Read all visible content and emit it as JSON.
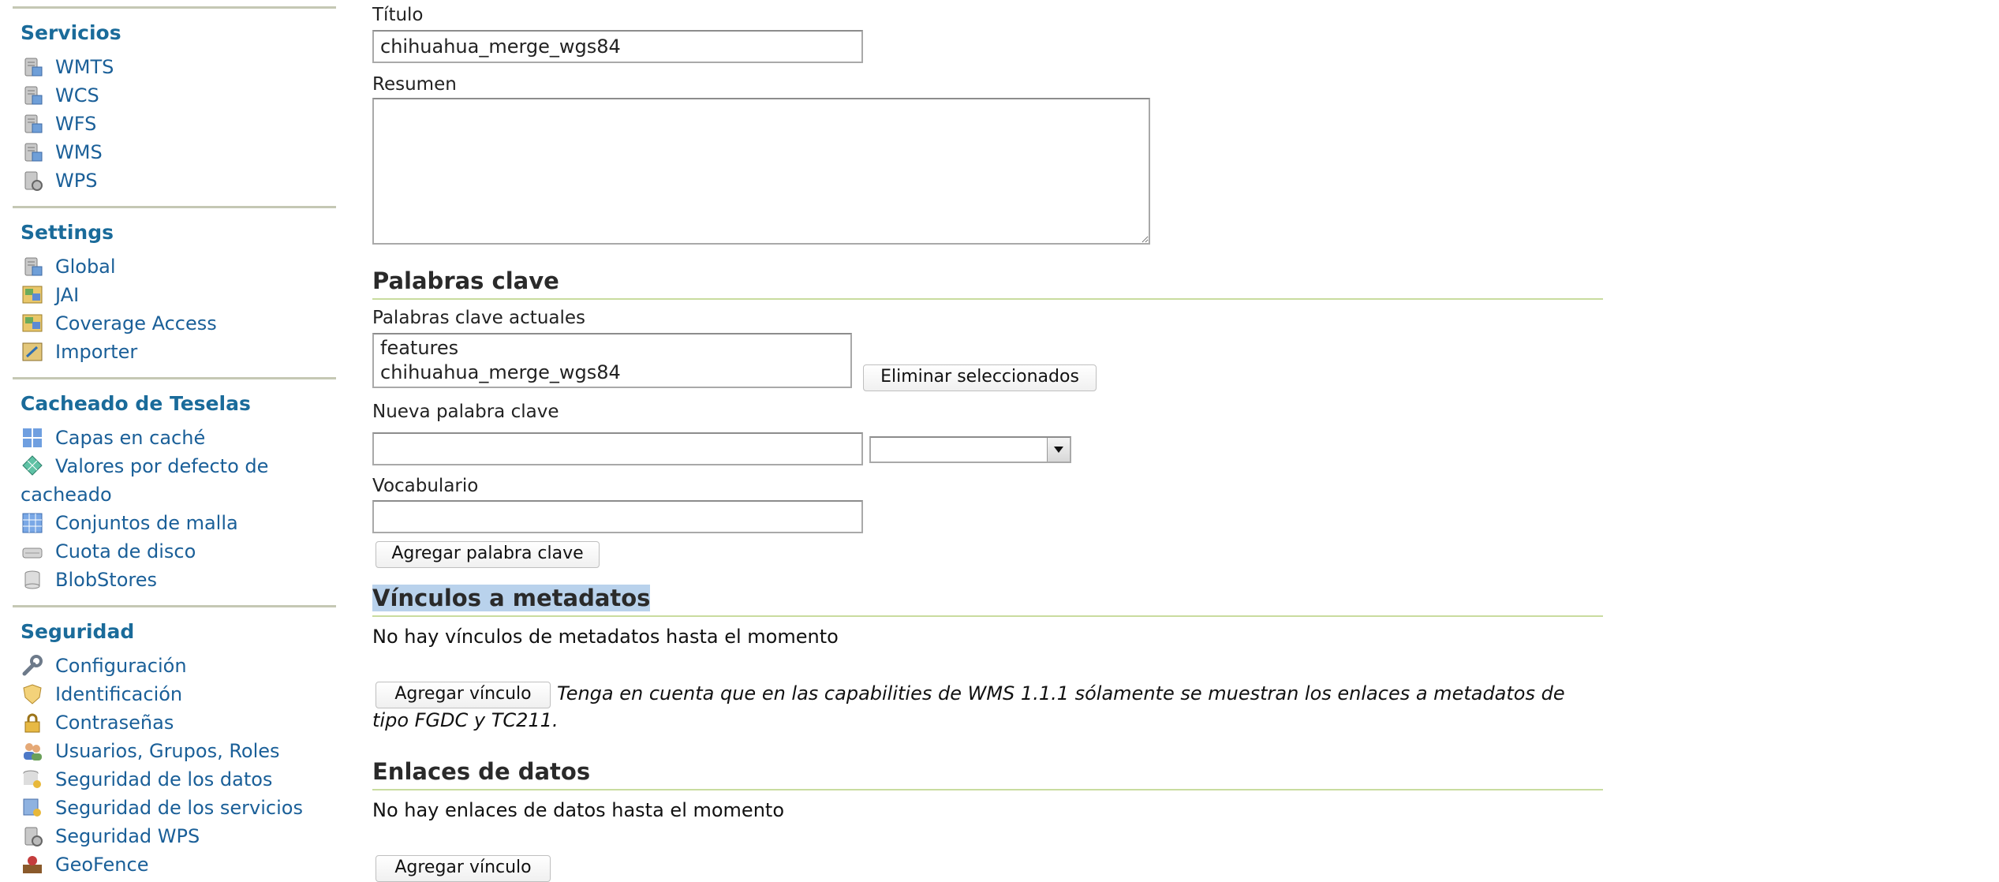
{
  "sidebar": {
    "sections": [
      {
        "title": "Servicios",
        "items": [
          {
            "label": "WMTS",
            "icon": "server-icon"
          },
          {
            "label": "WCS",
            "icon": "server-icon"
          },
          {
            "label": "WFS",
            "icon": "server-icon"
          },
          {
            "label": "WMS",
            "icon": "server-icon"
          },
          {
            "label": "WPS",
            "icon": "server-gear-icon"
          }
        ]
      },
      {
        "title": "Settings",
        "items": [
          {
            "label": "Global",
            "icon": "server-icon"
          },
          {
            "label": "JAI",
            "icon": "image-icon"
          },
          {
            "label": "Coverage Access",
            "icon": "image-icon"
          },
          {
            "label": "Importer",
            "icon": "import-icon"
          }
        ]
      },
      {
        "title": "Cacheado de Teselas",
        "items": [
          {
            "label": "Capas en caché",
            "icon": "layers-grid-icon"
          },
          {
            "label": "Valores por defecto de cacheado",
            "icon": "globe-grid-icon"
          },
          {
            "label": "Conjuntos de malla",
            "icon": "grid-icon"
          },
          {
            "label": "Cuota de disco",
            "icon": "disk-icon"
          },
          {
            "label": "BlobStores",
            "icon": "database-icon"
          }
        ]
      },
      {
        "title": "Seguridad",
        "items": [
          {
            "label": "Configuración",
            "icon": "wrench-icon"
          },
          {
            "label": "Identificación",
            "icon": "shield-icon"
          },
          {
            "label": "Contraseñas",
            "icon": "lock-icon"
          },
          {
            "label": "Usuarios, Grupos, Roles",
            "icon": "users-icon"
          },
          {
            "label": "Seguridad de los datos",
            "icon": "data-key-icon"
          },
          {
            "label": "Seguridad de los servicios",
            "icon": "service-key-icon"
          },
          {
            "label": "Seguridad WPS",
            "icon": "server-gear-icon"
          },
          {
            "label": "GeoFence",
            "icon": "geofence-icon"
          }
        ]
      }
    ]
  },
  "form": {
    "titulo_label": "Título",
    "titulo_value": "chihuahua_merge_wgs84",
    "resumen_label": "Resumen",
    "resumen_value": "",
    "keywords_heading": "Palabras clave",
    "current_keywords_label": "Palabras clave actuales",
    "current_keywords": [
      "features",
      "chihuahua_merge_wgs84"
    ],
    "remove_selected_button": "Eliminar seleccionados",
    "new_keyword_label": "Nueva palabra clave",
    "new_keyword_value": "",
    "language_select_value": "",
    "vocabulary_label": "Vocabulario",
    "vocabulary_value": "",
    "add_keyword_button": "Agregar palabra clave",
    "metadata_heading": "Vínculos a metadatos",
    "metadata_empty": "No hay vínculos de metadatos hasta el momento",
    "metadata_add_button": "Agregar vínculo",
    "metadata_note": "Tenga en cuenta que en las capabilities de WMS 1.1.1 sólamente se muestran los enlaces a metadatos de tipo FGDC y TC211.",
    "datalinks_heading": "Enlaces de datos",
    "datalinks_empty": "No hay enlaces de datos hasta el momento",
    "datalinks_add_button": "Agregar vínculo"
  },
  "colors": {
    "link": "#1a5f98",
    "section_title": "#1a6b9a",
    "heading_rule": "#c9dc9f",
    "highlight": "#b9d2ec"
  }
}
